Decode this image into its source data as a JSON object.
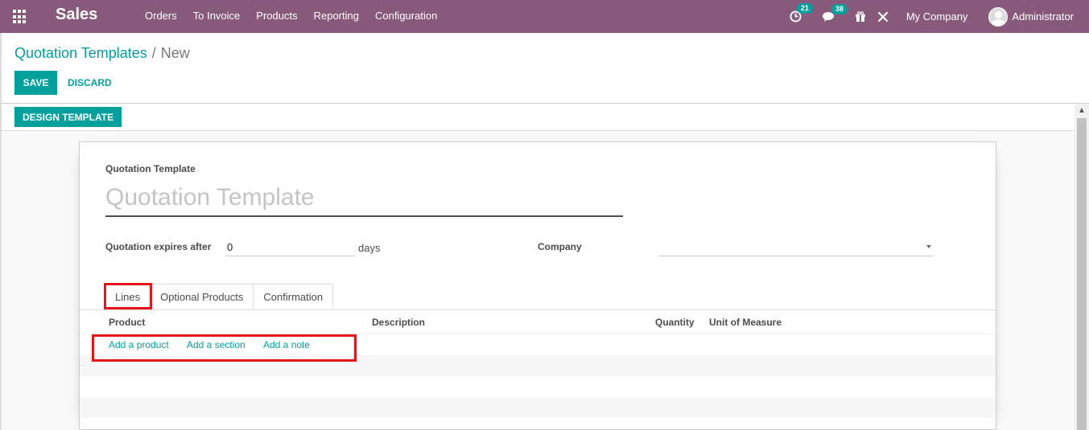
{
  "navbar": {
    "brand": "Sales",
    "menu": [
      "Orders",
      "To Invoice",
      "Products",
      "Reporting",
      "Configuration"
    ],
    "activity_count": "21",
    "message_count": "38",
    "company": "My Company",
    "user": "Administrator"
  },
  "breadcrumb": {
    "parent": "Quotation Templates",
    "separator": "/",
    "current": "New"
  },
  "actions": {
    "save": "Save",
    "discard": "Discard",
    "design_template": "Design Template"
  },
  "form": {
    "title_label": "Quotation Template",
    "title_placeholder": "Quotation Template",
    "expires_label": "Quotation expires after",
    "expires_value": "0",
    "expires_unit": "days",
    "company_label": "Company",
    "company_value": ""
  },
  "tabs": [
    "Lines",
    "Optional Products",
    "Confirmation"
  ],
  "table": {
    "columns": [
      "Product",
      "Description",
      "Quantity",
      "Unit of Measure"
    ],
    "add_links": [
      "Add a product",
      "Add a section",
      "Add a note"
    ]
  },
  "colors": {
    "navbar": "#875a7b",
    "accent": "#00a09d",
    "highlight": "#e8141c"
  }
}
